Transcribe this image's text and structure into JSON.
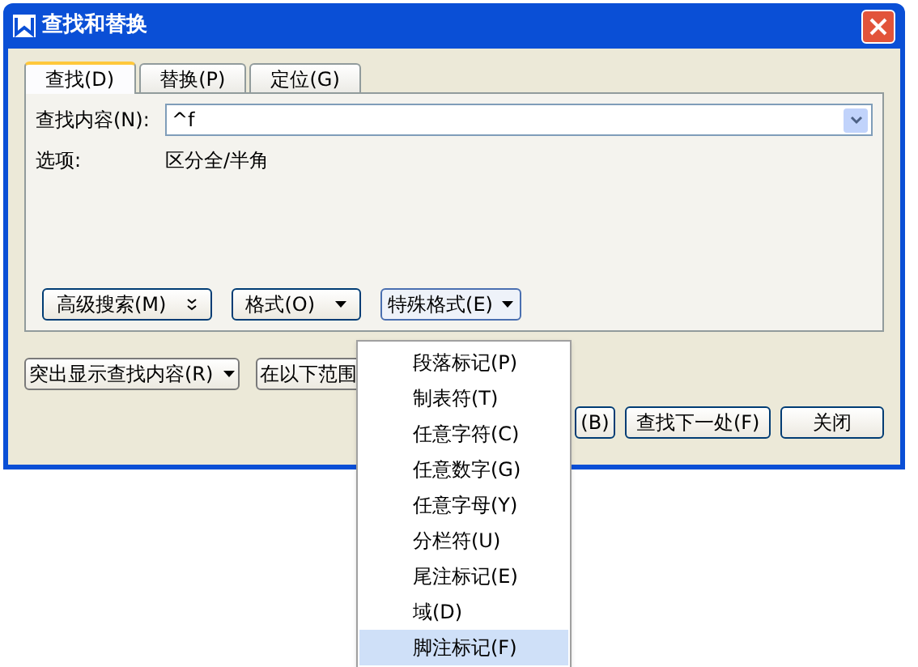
{
  "window": {
    "title": "查找和替换"
  },
  "tabs": [
    {
      "label": "查找(D)",
      "selected": true
    },
    {
      "label": "替换(P)",
      "selected": false
    },
    {
      "label": "定位(G)",
      "selected": false
    }
  ],
  "find_field": {
    "label": "查找内容(N):",
    "value": "^f"
  },
  "options": {
    "label": "选项:",
    "value": "区分全/半角"
  },
  "panel_buttons": [
    {
      "label": "高级搜索(M)",
      "kind": "expand"
    },
    {
      "label": "格式(O)",
      "kind": "dropdown"
    },
    {
      "label": "特殊格式(E)",
      "kind": "dropdown"
    }
  ],
  "bottom_row_1": [
    {
      "label": "突出显示查找内容(R)",
      "kind": "dropdown"
    },
    {
      "label": "在以下范围",
      "kind": "plain"
    }
  ],
  "bottom_row_2": [
    {
      "label": "(B)"
    },
    {
      "label": "查找下一处(F)"
    },
    {
      "label": "关闭"
    }
  ],
  "menu": [
    {
      "label": "段落标记(P)",
      "selected": false
    },
    {
      "label": "制表符(T)",
      "selected": false
    },
    {
      "label": "任意字符(C)",
      "selected": false
    },
    {
      "label": "任意数字(G)",
      "selected": false
    },
    {
      "label": "任意字母(Y)",
      "selected": false
    },
    {
      "label": "分栏符(U)",
      "selected": false
    },
    {
      "label": "尾注标记(E)",
      "selected": false
    },
    {
      "label": "域(D)",
      "selected": false
    },
    {
      "label": "脚注标记(F)",
      "selected": true
    }
  ]
}
